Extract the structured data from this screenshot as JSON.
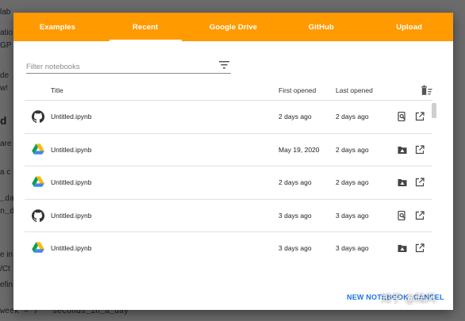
{
  "background": {
    "lines": [
      {
        "text": "lab",
        "cls": "sans"
      },
      {
        "text": "atio",
        "cls": "sans"
      },
      {
        "text": " GP",
        "cls": "sans"
      },
      {
        "text": "de",
        "cls": "sans"
      },
      {
        "text": "w!",
        "cls": "sans"
      },
      {
        "text": "d",
        "cls": "bg-bold"
      },
      {
        "text": "are",
        "cls": "sans"
      },
      {
        "text": " a c",
        "cls": "sans"
      },
      {
        "text": "_da",
        "cls": ""
      },
      {
        "text": "n_da",
        "cls": ""
      },
      {
        "text": "e in",
        "cls": "sans"
      },
      {
        "text": "/Ct",
        "cls": "sans"
      },
      {
        "text": "efin",
        "cls": "sans"
      },
      {
        "text": " week = 7 * seconds_in_a_day",
        "cls": ""
      }
    ]
  },
  "tabs": [
    {
      "label": "Examples",
      "active": false
    },
    {
      "label": "Recent",
      "active": true
    },
    {
      "label": "Google Drive",
      "active": false
    },
    {
      "label": "GitHub",
      "active": false
    },
    {
      "label": "Upload",
      "active": false
    }
  ],
  "filter": {
    "placeholder": "Filter notebooks"
  },
  "table": {
    "headers": {
      "title": "Title",
      "first": "First opened",
      "last": "Last opened"
    },
    "rows": [
      {
        "source": "github",
        "title": "Untitled.ipynb",
        "first": "2 days ago",
        "last": "2 days ago"
      },
      {
        "source": "drive",
        "title": "Untitled.ipynb",
        "first": "May 19, 2020",
        "last": "2 days ago"
      },
      {
        "source": "drive",
        "title": "Untitled.ipynb",
        "first": "2 days ago",
        "last": "2 days ago"
      },
      {
        "source": "github",
        "title": "Untitled.ipynb",
        "first": "3 days ago",
        "last": "3 days ago"
      },
      {
        "source": "drive",
        "title": "Untitled.ipynb",
        "first": "3 days ago",
        "last": "3 days ago"
      }
    ]
  },
  "footer": {
    "new_label": "NEW NOTEBOOK",
    "cancel_label": "CANCEL"
  },
  "watermark": "知乎 @陆风",
  "colors": {
    "accent": "#ff9a00",
    "link": "#1a73e8"
  }
}
